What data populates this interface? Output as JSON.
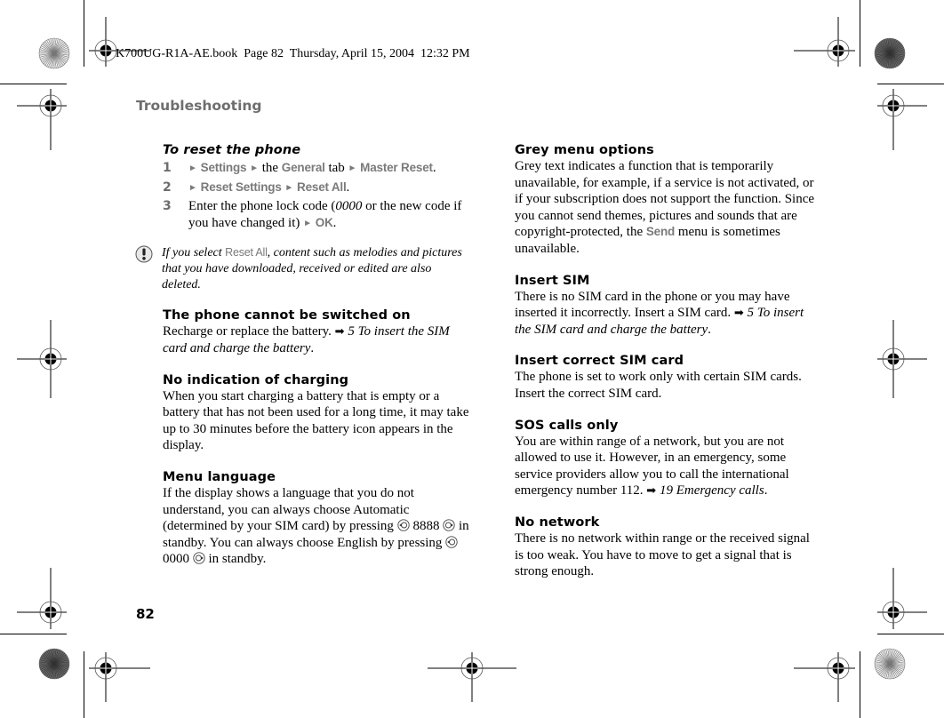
{
  "running_header": "K700UG-R1A-AE.book  Page 82  Thursday, April 15, 2004  12:32 PM",
  "section_title": "Troubleshooting",
  "page_number": "82",
  "colors": {
    "ui_grey": "#7a7a7a",
    "heading_grey": "#6e6e6e",
    "text": "#000000"
  },
  "reset": {
    "title": "To reset the phone",
    "steps": [
      {
        "num": "1",
        "parts": {
          "a": "Settings",
          "b": "the",
          "c": "General",
          "d": "tab",
          "e": "Master Reset",
          "end": "."
        }
      },
      {
        "num": "2",
        "parts": {
          "a": "Reset Settings",
          "b": "Reset All",
          "end": "."
        }
      },
      {
        "num": "3",
        "parts": {
          "pre": "Enter the phone lock code (",
          "code": "0000",
          "mid": " or the new code if you have changed it)",
          "ok": "OK",
          "end": "."
        }
      }
    ],
    "note": {
      "icon": "exclamation-note-icon",
      "pre": "If you select ",
      "ui": "Reset All",
      "post": ", content such as melodies and pictures that you have downloaded, received or edited are also deleted."
    }
  },
  "left_sections": {
    "cannot_switch_on": {
      "title": "The phone cannot be switched on",
      "text": "Recharge or replace the battery.",
      "ref": "5 To insert the SIM card and charge the battery",
      "end": "."
    },
    "no_charging": {
      "title": "No indication of charging",
      "text": "When you start charging a battery that is empty or a battery that has not been used for a long time, it may take up to 30 minutes before the battery icon appears in the display."
    },
    "menu_language": {
      "title": "Menu language",
      "text1": "If the display shows a language that you do not understand, you can always choose Automatic (determined by your SIM card) by pressing",
      "code1": "8888",
      "text2": "in standby. You can always choose English by pressing",
      "code2": "0000",
      "text3": "in standby."
    }
  },
  "right_sections": {
    "grey_menu": {
      "title": "Grey menu options",
      "pre": "Grey text indicates a function that is temporarily unavailable, for example, if a service is not activated, or if your subscription does not support the function. Since you cannot send themes, pictures and sounds that are copyright-protected, the ",
      "ui": "Send",
      "post": " menu is sometimes unavailable."
    },
    "insert_sim": {
      "title": "Insert SIM",
      "text": "There is no SIM card in the phone or you may have inserted it incorrectly. Insert a SIM card.",
      "ref": "5 To insert the SIM card and charge the battery",
      "end": "."
    },
    "insert_correct_sim": {
      "title": "Insert correct SIM card",
      "text": "The phone is set to work only with certain SIM cards. Insert the correct SIM card."
    },
    "sos_only": {
      "title": "SOS calls only",
      "text": "You are within range of a network, but you are not allowed to use it. However, in an emergency, some service providers allow you to call the international emergency number 112.",
      "ref": "19 Emergency calls",
      "end": "."
    },
    "no_network": {
      "title": "No network",
      "text": "There is no network within range or the received signal is too weak. You have to move to get a signal that is strong enough."
    }
  },
  "glyphs": {
    "menu_arrow": "►",
    "ref_arrow": "➡"
  }
}
